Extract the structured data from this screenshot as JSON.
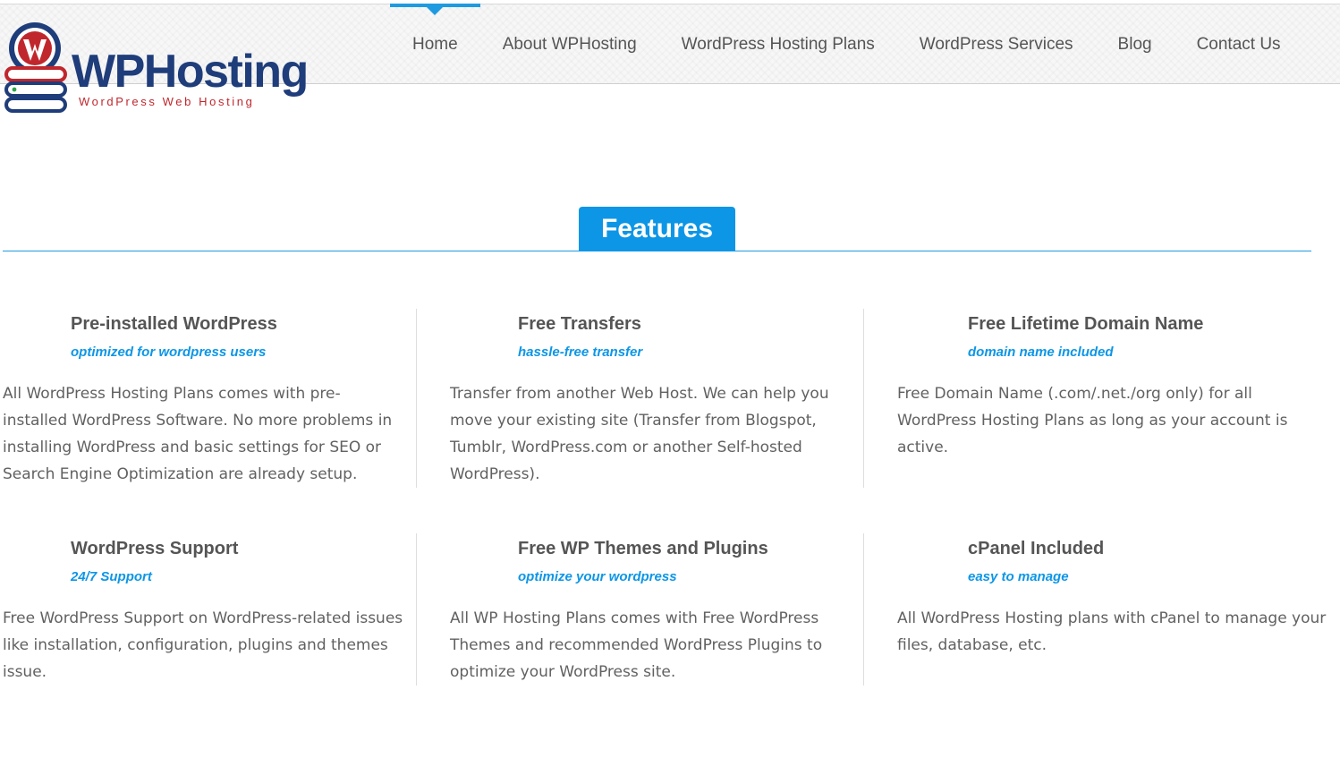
{
  "brand": {
    "name": "WPHosting",
    "tagline": "WordPress Web Hosting",
    "colors": {
      "navy": "#1f3d7a",
      "red": "#c0272d",
      "accent": "#0d96e6"
    }
  },
  "nav": {
    "items": [
      {
        "label": "Home",
        "active": true
      },
      {
        "label": "About WPHosting",
        "active": false
      },
      {
        "label": "WordPress Hosting Plans",
        "active": false
      },
      {
        "label": "WordPress Services",
        "active": false
      },
      {
        "label": "Blog",
        "active": false
      },
      {
        "label": "Contact Us",
        "active": false
      }
    ]
  },
  "section": {
    "title": "Features"
  },
  "features": [
    {
      "title": "Pre-installed WordPress",
      "subtitle": "optimized for wordpress users",
      "description": "All WordPress Hosting Plans comes with pre-installed WordPress Software. No more problems in installing WordPress and basic settings for SEO or Search Engine Optimization are already setup."
    },
    {
      "title": "Free Transfers",
      "subtitle": "hassle-free transfer",
      "description": "Transfer from another Web Host. We can help you move your existing site (Transfer from Blogspot, Tumblr, WordPress.com or another Self-hosted WordPress)."
    },
    {
      "title": "Free Lifetime Domain Name",
      "subtitle": "domain name included",
      "description": "Free Domain Name (.com/.net./org only) for all WordPress Hosting Plans as long as your account is active."
    },
    {
      "title": "WordPress Support",
      "subtitle": "24/7 Support",
      "description": "Free WordPress Support on WordPress-related issues like installation, configuration, plugins and themes issue."
    },
    {
      "title": "Free WP Themes and Plugins",
      "subtitle": "optimize your wordpress",
      "description": "All WP Hosting Plans comes with Free WordPress Themes and recommended WordPress Plugins to optimize your WordPress site."
    },
    {
      "title": "cPanel Included",
      "subtitle": "easy to manage",
      "description": "All WordPress Hosting plans with cPanel to manage your files, database, etc."
    }
  ]
}
